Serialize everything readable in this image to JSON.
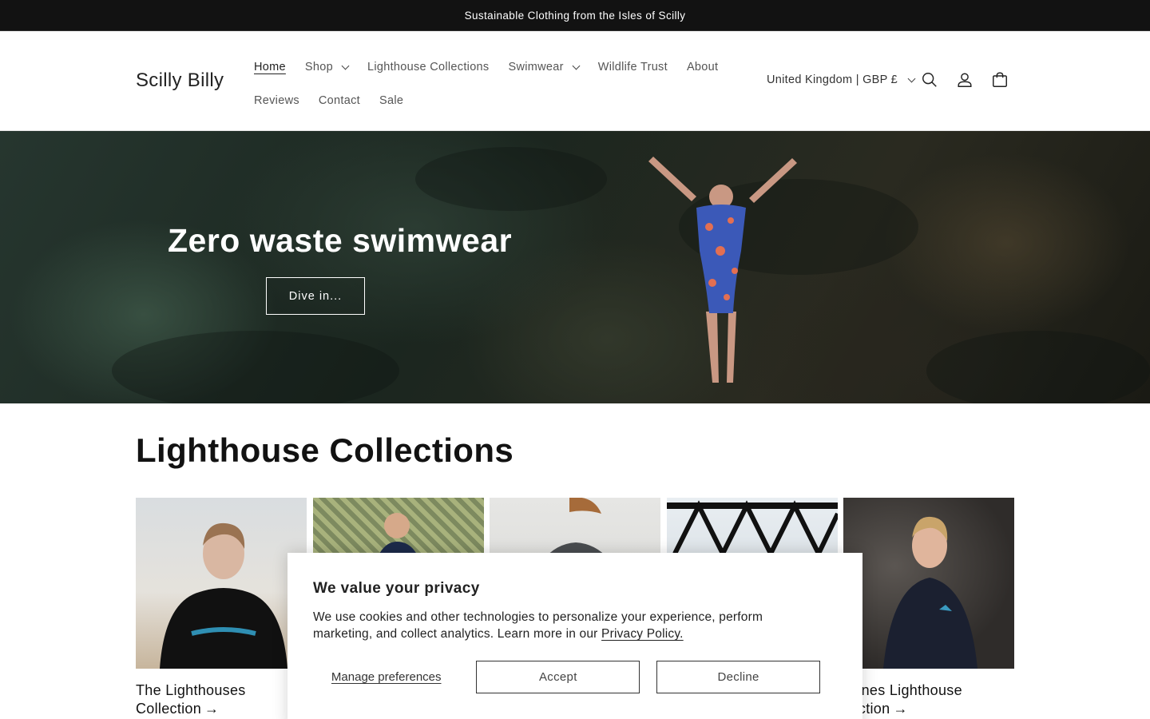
{
  "announcement": "Sustainable Clothing from the Isles of Scilly",
  "logo": "Scilly Billy",
  "nav": [
    {
      "label": "Home",
      "has_dropdown": false
    },
    {
      "label": "Shop",
      "has_dropdown": true
    },
    {
      "label": "Lighthouse Collections",
      "has_dropdown": false
    },
    {
      "label": "Swimwear",
      "has_dropdown": true
    },
    {
      "label": "Wildlife Trust",
      "has_dropdown": false
    },
    {
      "label": "About",
      "has_dropdown": false
    },
    {
      "label": "Reviews",
      "has_dropdown": false
    },
    {
      "label": "Contact",
      "has_dropdown": false
    },
    {
      "label": "Sale",
      "has_dropdown": false
    }
  ],
  "country_selector": "United Kingdom | GBP £",
  "icons": [
    "search-icon",
    "account-icon",
    "cart-icon"
  ],
  "hero": {
    "title": "Zero waste swimwear",
    "button": "Dive in..."
  },
  "section": {
    "title": "Lighthouse Collections",
    "cards": [
      {
        "title_line1": "The Lighthouses",
        "title_line2": "Collection"
      },
      {
        "title_line1": "",
        "title_line2": ""
      },
      {
        "title_line1": "",
        "title_line2": ""
      },
      {
        "title_line1": "",
        "title_line2": ""
      },
      {
        "title_line1": "Agnes Lighthouse",
        "title_line2": "llection"
      }
    ]
  },
  "cookie": {
    "title": "We value your privacy",
    "text": "We use cookies and other technologies to personalize your experience, perform marketing, and collect analytics. Learn more in our ",
    "link": "Privacy Policy.",
    "manage": "Manage preferences",
    "accept": "Accept",
    "decline": "Decline"
  }
}
